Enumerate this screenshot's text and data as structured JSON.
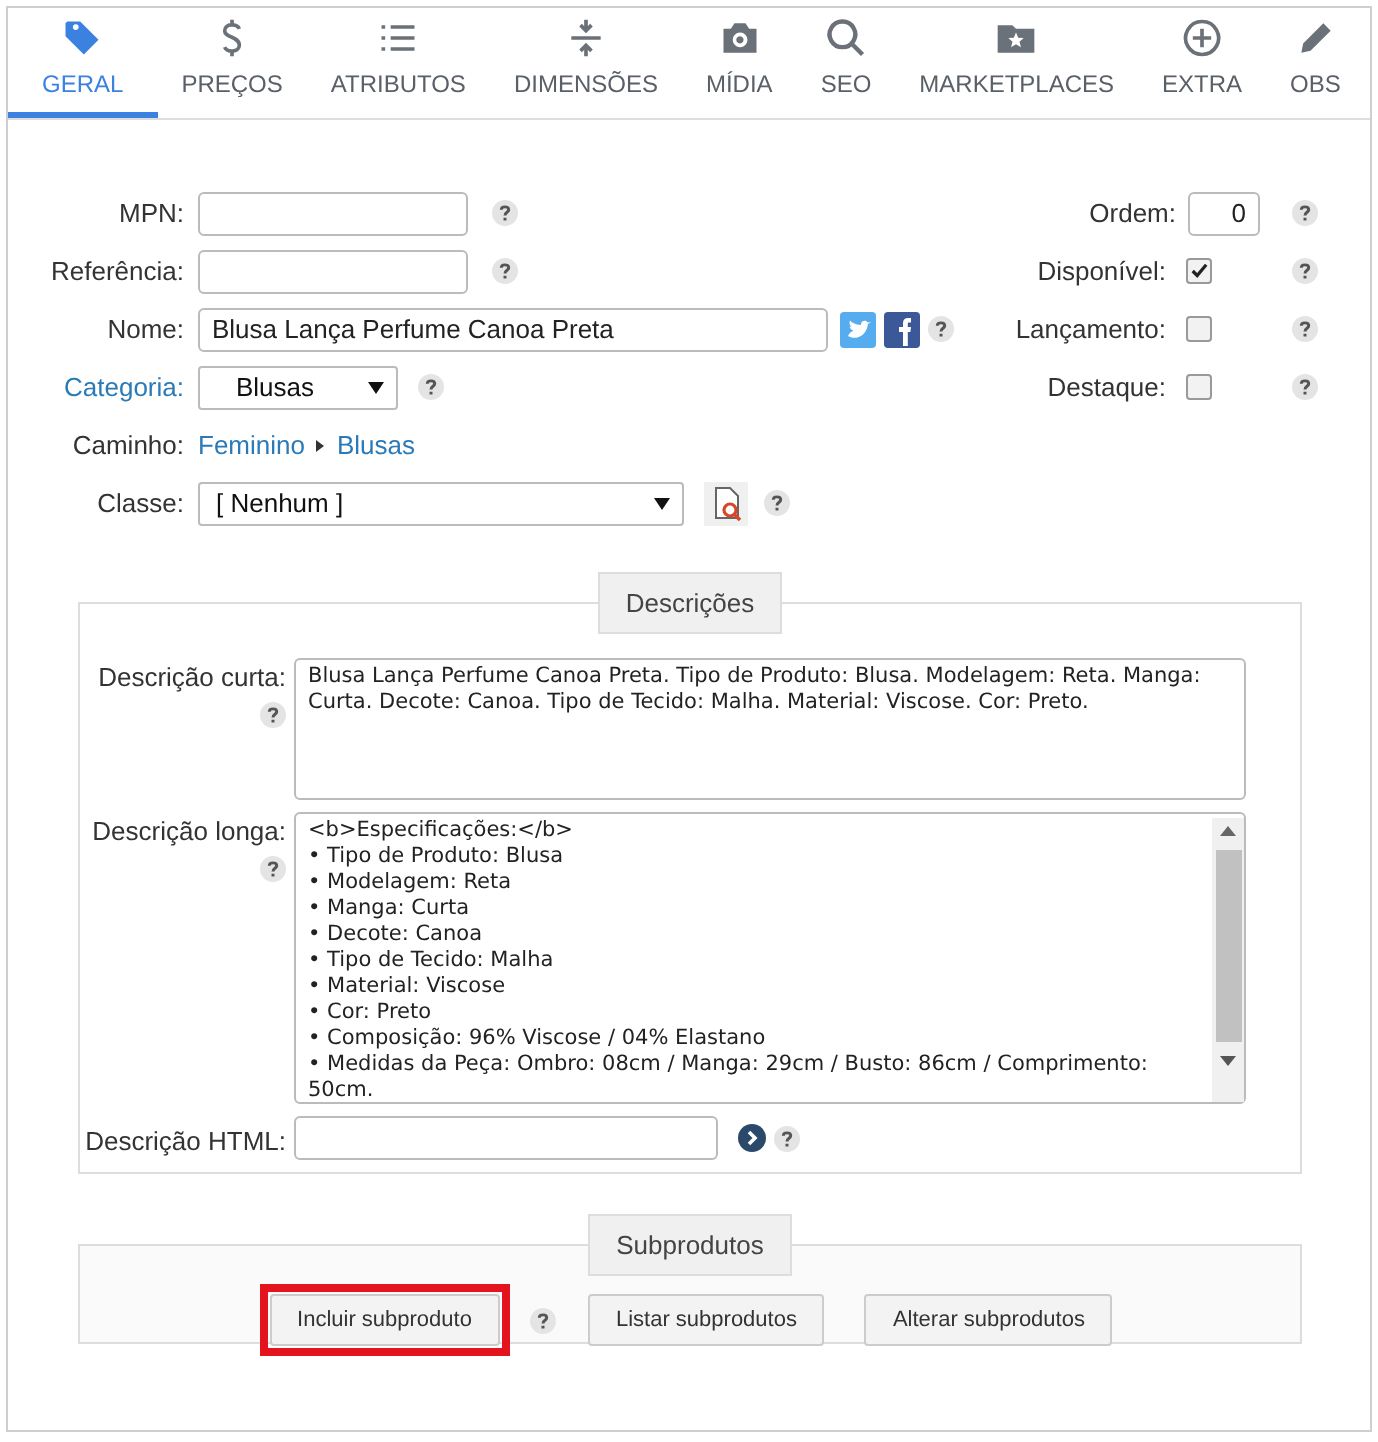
{
  "tabs": [
    {
      "label": "GERAL",
      "selected": true
    },
    {
      "label": "PREÇOS",
      "selected": false
    },
    {
      "label": "ATRIBUTOS",
      "selected": false
    },
    {
      "label": "DIMENSÕES",
      "selected": false
    },
    {
      "label": "MÍDIA",
      "selected": false
    },
    {
      "label": "SEO",
      "selected": false
    },
    {
      "label": "MARKETPLACES",
      "selected": false
    },
    {
      "label": "EXTRA",
      "selected": false
    },
    {
      "label": "OBS",
      "selected": false
    }
  ],
  "form": {
    "mpn": {
      "label": "MPN:"
    },
    "referencia": {
      "label": "Referência:"
    },
    "nome": {
      "label": "Nome:",
      "value": "Blusa Lança Perfume Canoa Preta"
    },
    "categoria": {
      "label": "Categoria:",
      "value": "Blusas"
    },
    "caminho": {
      "label": "Caminho:",
      "links": [
        "Feminino",
        "Blusas"
      ]
    },
    "classe": {
      "label": "Classe:",
      "value": "[ Nenhum ]"
    }
  },
  "options": {
    "ordem": {
      "label": "Ordem:",
      "value": "0"
    },
    "flags": [
      {
        "label": "Disponível:",
        "checked": true
      },
      {
        "label": "Lançamento:",
        "checked": false
      },
      {
        "label": "Destaque:",
        "checked": false
      }
    ]
  },
  "descricoes": {
    "title": "Descrições",
    "curta": {
      "label": "Descrição curta:",
      "value": "Blusa Lança Perfume Canoa Preta. Tipo de Produto: Blusa. Modelagem: Reta. Manga: Curta. Decote: Canoa. Tipo de Tecido: Malha. Material: Viscose. Cor: Preto."
    },
    "longa": {
      "label": "Descrição longa:",
      "lines": [
        "<b>Especificações:</b>",
        "• Tipo de Produto: Blusa",
        "• Modelagem: Reta",
        "• Manga: Curta",
        "• Decote: Canoa",
        "• Tipo de Tecido: Malha",
        "• Material: Viscose",
        "• Cor: Preto",
        "• Composição: 96% Viscose / 04% Elastano",
        "• Medidas da Peça: Ombro: 08cm / Manga: 29cm / Busto: 86cm / Comprimento: 50cm."
      ]
    },
    "html": {
      "label": "Descrição HTML:"
    }
  },
  "subprodutos": {
    "title": "Subprodutos",
    "buttons": [
      {
        "label": "Incluir subproduto",
        "highlighted": true,
        "help": true
      },
      {
        "label": "Listar subprodutos",
        "highlighted": false,
        "help": false
      },
      {
        "label": "Alterar subprodutos",
        "highlighted": false,
        "help": false
      }
    ]
  }
}
